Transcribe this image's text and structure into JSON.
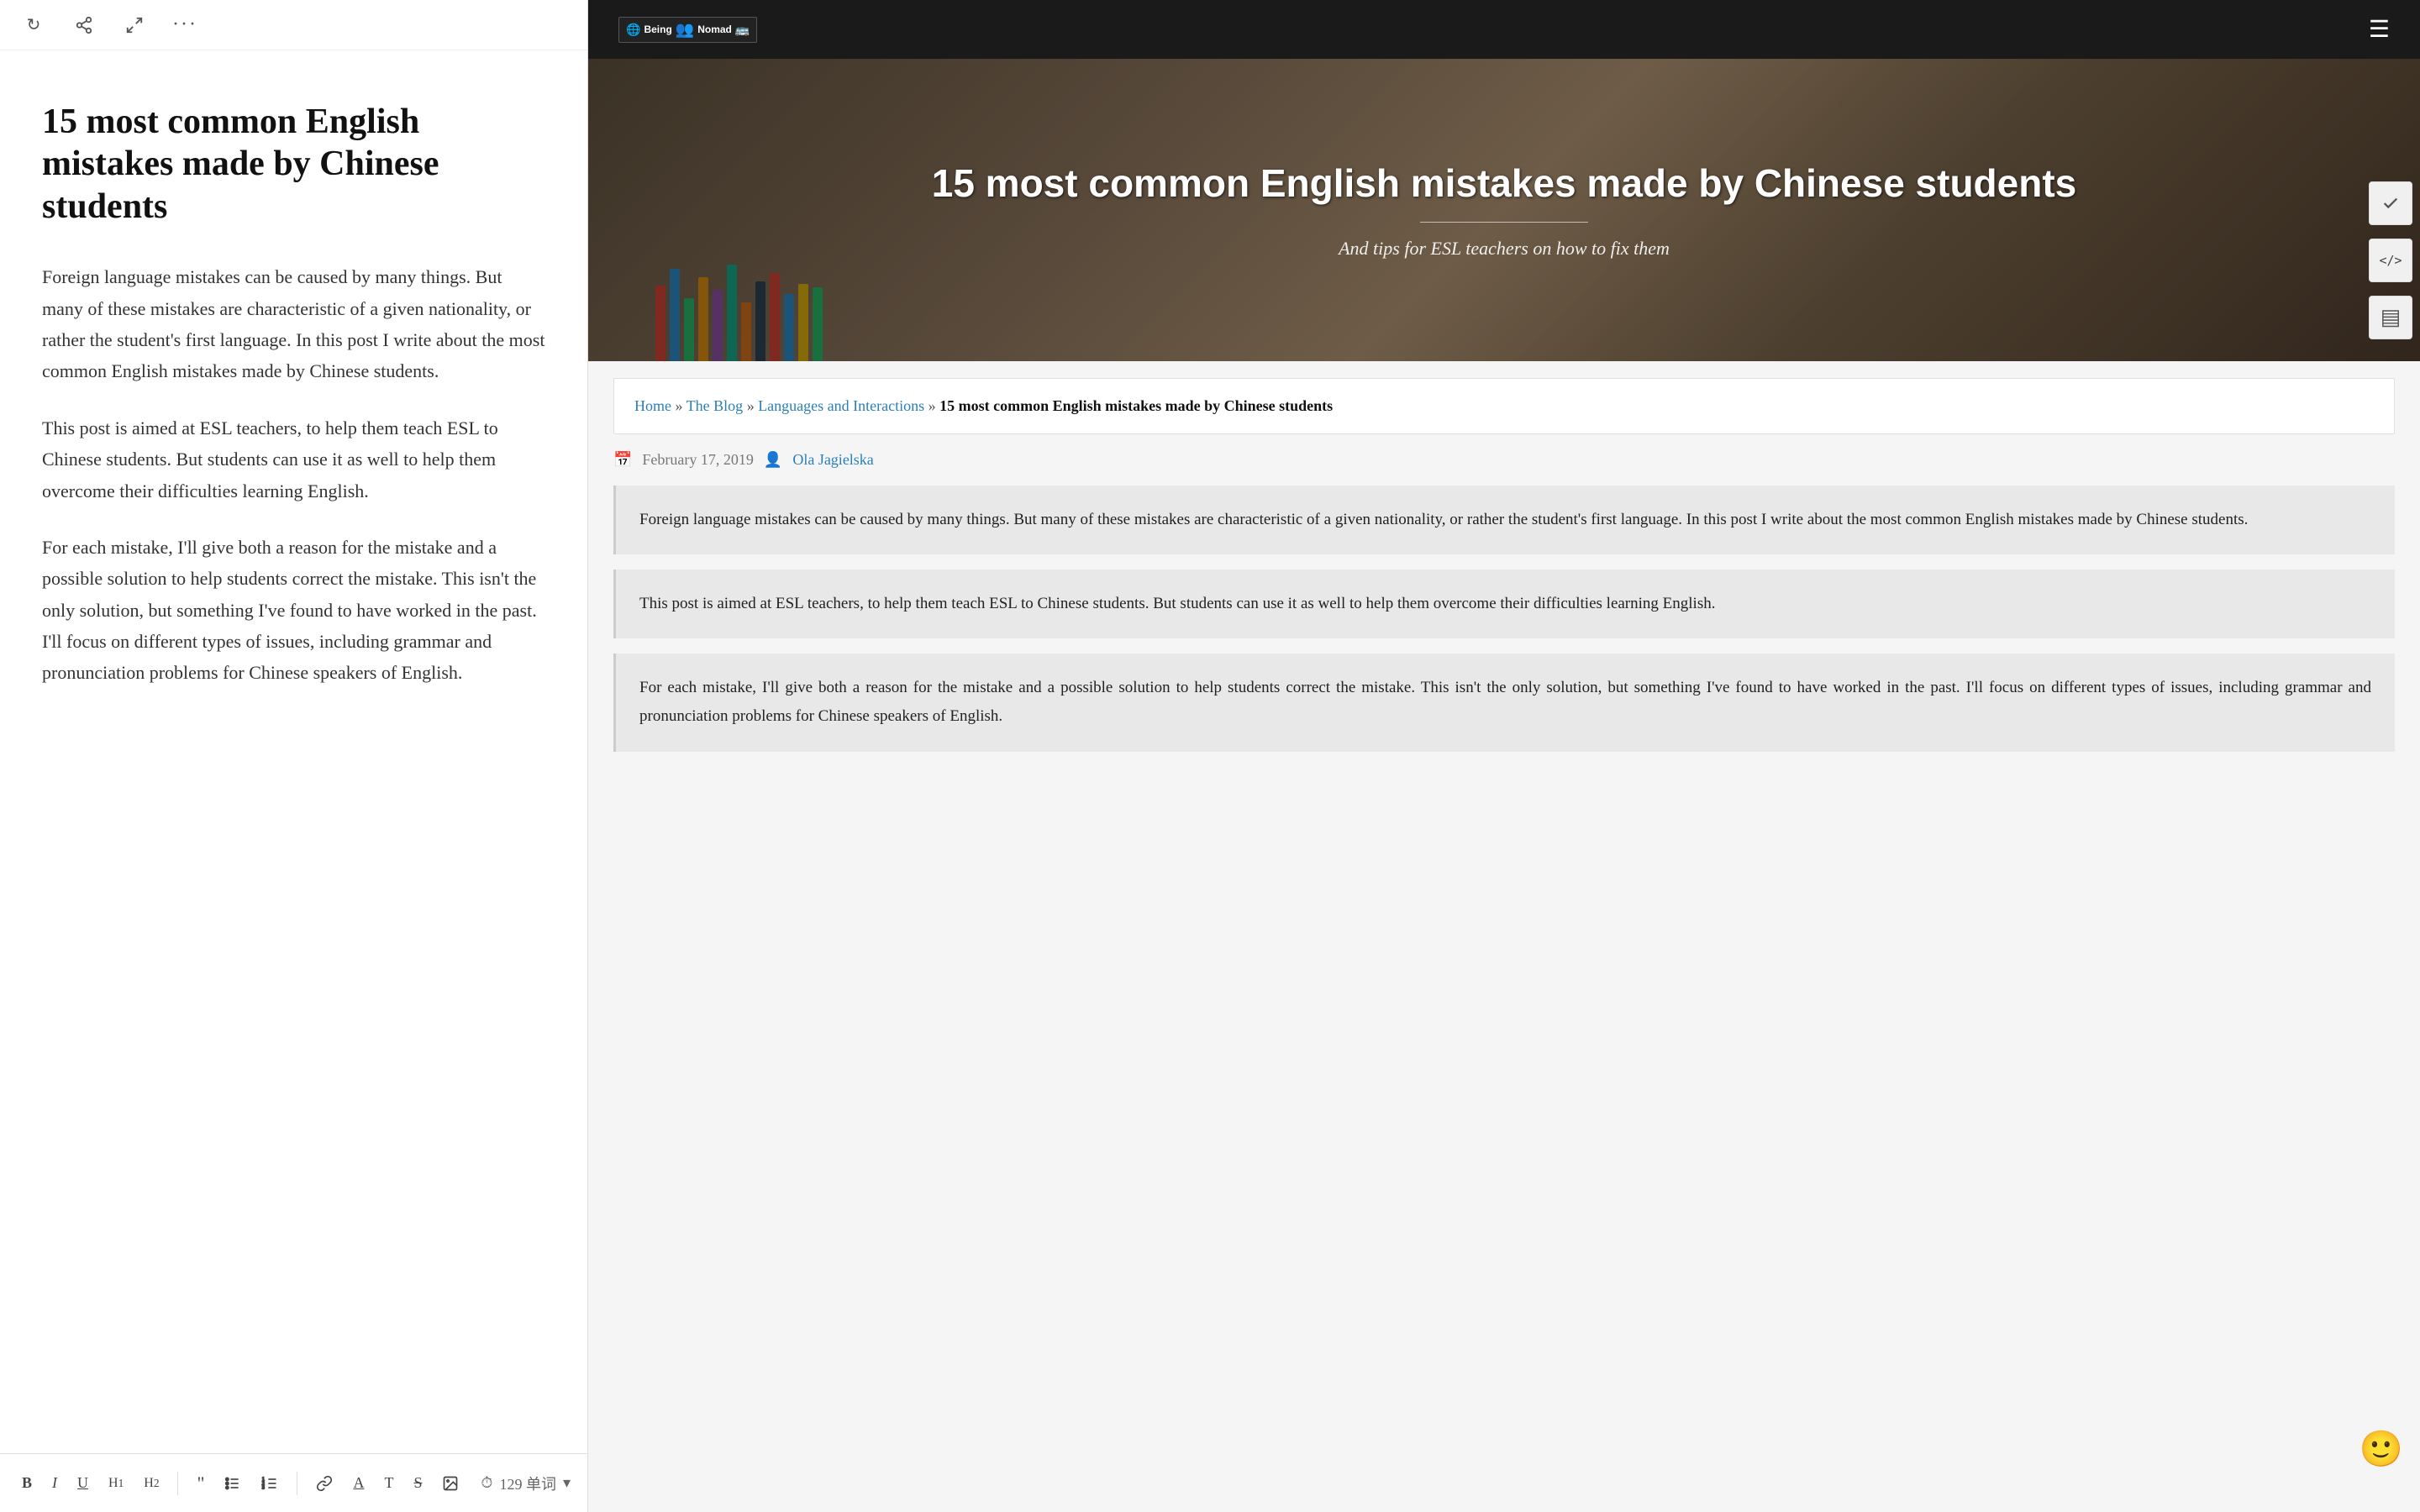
{
  "left": {
    "toolbar": {
      "refresh_icon": "↻",
      "share_icon": "⤢",
      "expand_icon": "⤡",
      "more_icon": "···"
    },
    "title": "15 most common English mistakes made by Chinese students",
    "paragraphs": [
      "Foreign language mistakes can be caused by many things. But many of these mistakes are characteristic of a given nationality, or rather the student's first language. In this post I write about the most common English mistakes made by Chinese students.",
      "This post is aimed at ESL teachers, to help them teach ESL to Chinese students. But students can use it as well to help them overcome their difficulties learning English.",
      "For each mistake, I'll give both a reason for the mistake and a possible solution to help students correct the mistake. This isn't the only solution, but something I've found to have worked in the past. I'll focus on different types of issues, including grammar and pronunciation problems for Chinese speakers of English."
    ],
    "bottom_toolbar": {
      "bold": "B",
      "italic": "I",
      "underline": "U",
      "h1": "H₁",
      "h2": "H₂",
      "quote": "❝",
      "list_ul": "≡",
      "list_ol": "≣",
      "link": "⛓",
      "underline2": "A̲",
      "text": "T",
      "strikethrough": "S̶",
      "image": "▣",
      "clock_icon": "⏱",
      "word_count": "129 单词",
      "chevron_icon": "▾"
    }
  },
  "right": {
    "site": {
      "logo_box": "🌐",
      "logo_text": "Being Nomad",
      "hamburger": "☰"
    },
    "hero": {
      "title": "15 most common English mistakes made by Chinese students",
      "subtitle": "And tips for ESL teachers on how to fix them",
      "pencil_colors": [
        "#e74c3c",
        "#3498db",
        "#2ecc71",
        "#f39c12",
        "#9b59b6",
        "#1abc9c",
        "#e67e22",
        "#34495e"
      ]
    },
    "breadcrumb": {
      "home": "Home",
      "sep1": "»",
      "blog": "The Blog",
      "sep2": "»",
      "category": "Languages and Interactions",
      "sep3": "»",
      "current": "15 most common English mistakes made by Chinese students"
    },
    "meta": {
      "date": "February 17, 2019",
      "author": "Ola Jagielska"
    },
    "paragraphs": [
      "Foreign language mistakes can be caused by many things. But many of these mistakes are characteristic of a given nationality, or rather the student's first language. In this post I write about the most common English mistakes made by Chinese students.",
      "This post is aimed at ESL teachers, to help them teach ESL to Chinese students. But students can use it as well to help them overcome their difficulties learning English.",
      "For each mistake, I'll give both a reason for the mistake and a possible solution to help students correct the mistake. This isn't the only solution, but something I've found to have worked in the past. I'll focus on different types of issues, including grammar and pronunciation problems for Chinese speakers of English."
    ],
    "sidebar_icons": {
      "check": "✓",
      "code": "</>",
      "stack": "▤"
    },
    "floating_emoji": "🙂"
  }
}
